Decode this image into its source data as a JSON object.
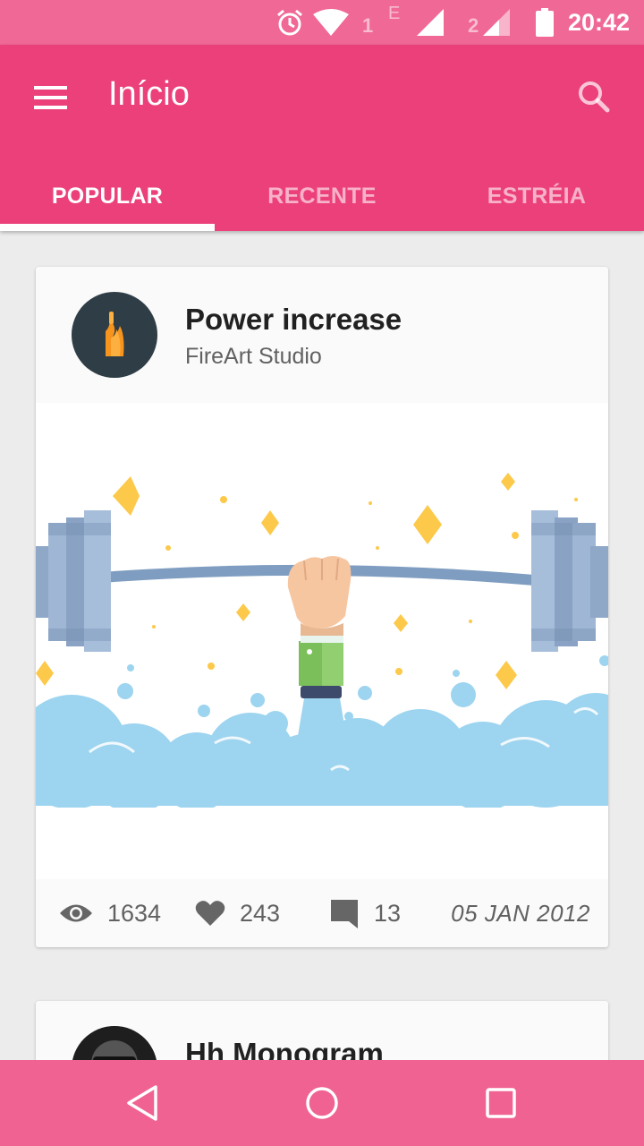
{
  "status_bar": {
    "sim1": "1",
    "sim_e": "E",
    "sim2": "2",
    "time": "20:42"
  },
  "app_bar": {
    "title": "Início",
    "menu_icon": "menu-icon",
    "search_icon": "search-icon"
  },
  "tabs": [
    {
      "label": "POPULAR",
      "active": true
    },
    {
      "label": "RECENTE",
      "active": false
    },
    {
      "label": "ESTRÉIA",
      "active": false
    }
  ],
  "cards": [
    {
      "title": "Power increase",
      "author": "FireArt Studio",
      "views": "1634",
      "likes": "243",
      "comments": "13",
      "date": "05 JAN 2012"
    },
    {
      "title": "Hh Monogram"
    }
  ],
  "nav_bar": {
    "back_icon": "back-icon",
    "home_icon": "home-icon",
    "recents_icon": "recents-icon"
  },
  "colors": {
    "primary": "#ec407a",
    "status_bar": "#f06895",
    "nav_bar": "#f06292",
    "background": "#ececec"
  }
}
